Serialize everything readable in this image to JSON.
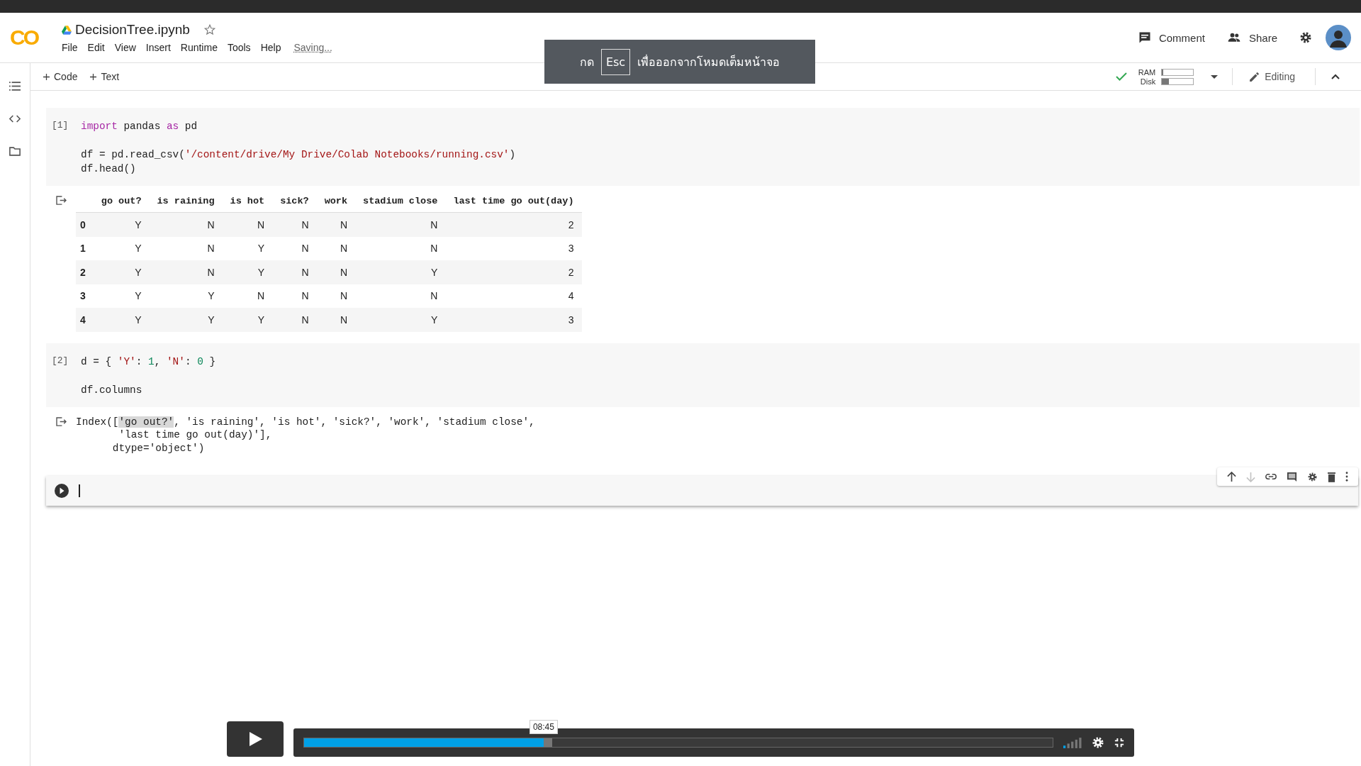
{
  "header": {
    "logo": "CO",
    "title": "DecisionTree.ipynb",
    "menu": [
      "File",
      "Edit",
      "View",
      "Insert",
      "Runtime",
      "Tools",
      "Help"
    ],
    "status": "Saving...",
    "actions": [
      "Comment",
      "Share"
    ]
  },
  "toolbar": {
    "add": [
      "Code",
      "Text"
    ],
    "resources": [
      {
        "label": "RAM",
        "level": 0.04
      },
      {
        "label": "Disk",
        "level": 0.22
      }
    ],
    "mode": "Editing"
  },
  "toast": {
    "before": "กด",
    "key": "Esc",
    "after": "เพื่อออกจากโหมดเต็มหน้าจอ"
  },
  "cells": [
    {
      "count": "[1]",
      "code": [
        {
          "kind": "kw",
          "text": "import"
        },
        {
          "kind": "plain",
          "text": " pandas "
        },
        {
          "kind": "kw",
          "text": "as"
        },
        {
          "kind": "plain",
          "text": " pd\n\ndf = pd.read_csv("
        },
        {
          "kind": "str",
          "text": "'/content/drive/My Drive/Colab Notebooks/running.csv'"
        },
        {
          "kind": "plain",
          "text": ")\ndf.head()"
        }
      ],
      "output": {
        "kind": "table",
        "columns": [
          "go out?",
          "is raining",
          "is hot",
          "sick?",
          "work",
          "stadium close",
          "last time go out(day)"
        ],
        "rows": [
          {
            "index": "0",
            "cells": [
              "Y",
              "N",
              "N",
              "N",
              "N",
              "N",
              "2"
            ]
          },
          {
            "index": "1",
            "cells": [
              "Y",
              "N",
              "Y",
              "N",
              "N",
              "N",
              "3"
            ]
          },
          {
            "index": "2",
            "cells": [
              "Y",
              "N",
              "Y",
              "N",
              "N",
              "Y",
              "2"
            ]
          },
          {
            "index": "3",
            "cells": [
              "Y",
              "Y",
              "N",
              "N",
              "N",
              "N",
              "4"
            ]
          },
          {
            "index": "4",
            "cells": [
              "Y",
              "Y",
              "Y",
              "N",
              "N",
              "Y",
              "3"
            ]
          }
        ]
      }
    },
    {
      "count": "[2]",
      "code": [
        {
          "kind": "plain",
          "text": "d = { "
        },
        {
          "kind": "str",
          "text": "'Y'"
        },
        {
          "kind": "plain",
          "text": ": "
        },
        {
          "kind": "num",
          "text": "1"
        },
        {
          "kind": "plain",
          "text": ", "
        },
        {
          "kind": "str",
          "text": "'N'"
        },
        {
          "kind": "plain",
          "text": ": "
        },
        {
          "kind": "num",
          "text": "0"
        },
        {
          "kind": "plain",
          "text": " }\n\ndf.columns"
        }
      ],
      "output": {
        "kind": "text",
        "lines": [
          [
            {
              "kind": "plain",
              "text": "Index(["
            },
            {
              "kind": "hl",
              "text": "'go out?'"
            },
            {
              "kind": "plain",
              "text": ", 'is raining', 'is hot', 'sick?', 'work', 'stadium close',"
            }
          ],
          [
            {
              "kind": "plain",
              "text": "       'last time go out(day)'],"
            }
          ],
          [
            {
              "kind": "plain",
              "text": "      dtype='object')"
            }
          ]
        ]
      }
    }
  ],
  "cell_toolbar": [
    {
      "kind": "up",
      "disabled": false
    },
    {
      "kind": "down",
      "disabled": true
    },
    {
      "kind": "link",
      "disabled": false
    },
    {
      "kind": "comment",
      "disabled": false
    },
    {
      "kind": "settings",
      "disabled": false
    },
    {
      "kind": "delete",
      "disabled": false
    },
    {
      "kind": "more",
      "disabled": false
    }
  ],
  "player": {
    "time": "08:45",
    "level": 0.32,
    "volume": {
      "level": 0.2
    }
  }
}
